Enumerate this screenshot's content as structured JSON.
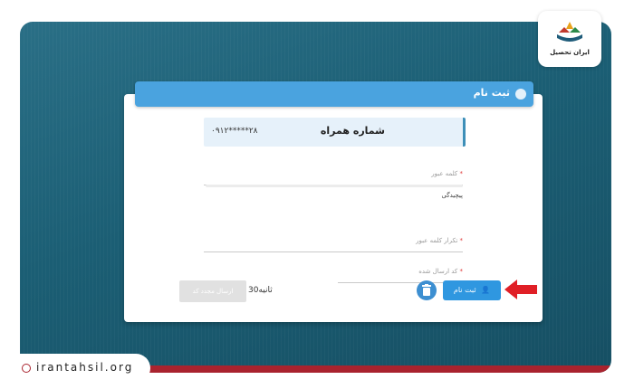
{
  "form": {
    "title": "ثبت نام",
    "phone_label": "شماره همراه",
    "phone_value": "۰۹۱۲*****۲۸",
    "password_placeholder": "کلمه عبور",
    "complexity_label": "پیچیدگی",
    "repeat_password_placeholder": "تکرار کلمه عبور",
    "code_placeholder": "کد ارسال شده",
    "required_mark": "*",
    "send_code_label": "ارسال مجدد کد",
    "timer_text": "ثانیه30",
    "register_label": "ثبت نام"
  },
  "branding": {
    "logo_name": "ایران تحصیل",
    "site_url": "irantahsil.org"
  },
  "colors": {
    "accent": "#2f97e0",
    "header": "#4aa3df",
    "arrow": "#e01f26"
  }
}
